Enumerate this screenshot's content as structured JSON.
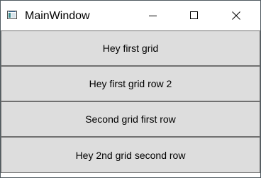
{
  "window": {
    "title": "MainWindow",
    "icon": "app-window-icon",
    "controls": {
      "minimize_icon": "minimize-icon",
      "maximize_icon": "maximize-icon",
      "close_icon": "close-icon"
    }
  },
  "buttons": [
    {
      "label": "Hey first grid"
    },
    {
      "label": "Hey first grid row 2"
    },
    {
      "label": "Second grid first row"
    },
    {
      "label": "Hey 2nd grid second row"
    }
  ],
  "colors": {
    "button_face": "#dddddd",
    "button_border": "#707070",
    "titlebar": "#ffffff"
  }
}
